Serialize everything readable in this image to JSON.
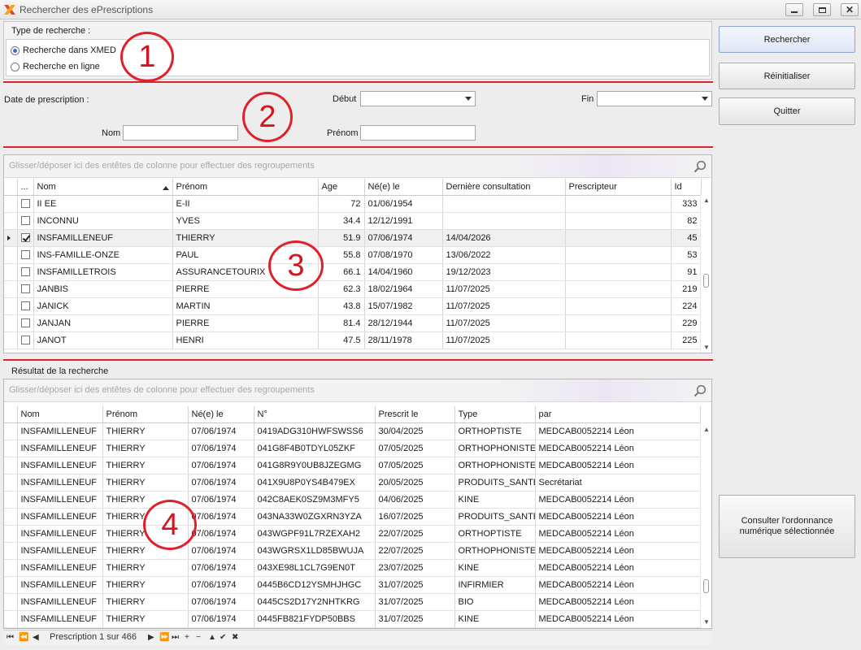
{
  "window": {
    "title": "Rechercher des ePrescriptions"
  },
  "search_type": {
    "label": "Type de recherche :",
    "options": [
      {
        "label": "Recherche dans XMED",
        "selected": true
      },
      {
        "label": "Recherche en ligne",
        "selected": false
      }
    ]
  },
  "filters": {
    "date_label": "Date de prescription :",
    "debut_label": "Début",
    "fin_label": "Fin",
    "nom_label": "Nom",
    "prenom_label": "Prénom",
    "debut_value": "",
    "fin_value": "",
    "nom_value": "",
    "prenom_value": ""
  },
  "annotations": [
    "1",
    "2",
    "3",
    "4"
  ],
  "patients": {
    "group_hint": "Glisser/déposer ici des entêtes de colonne pour effectuer des regroupements",
    "headers": [
      "...",
      "Nom",
      "Prénom",
      "Age",
      "Né(e) le",
      "Dernière consultation",
      "Prescripteur",
      "Id"
    ],
    "rows": [
      {
        "checked": false,
        "current": false,
        "nom": "II EE",
        "prenom": "E-II",
        "age": "72",
        "ne": "01/06/1954",
        "derniere": "",
        "prescripteur": "",
        "id": "333"
      },
      {
        "checked": false,
        "current": false,
        "nom": "INCONNU",
        "prenom": "YVES",
        "age": "34.4",
        "ne": "12/12/1991",
        "derniere": "",
        "prescripteur": "",
        "id": "82"
      },
      {
        "checked": true,
        "current": true,
        "nom": "INSFAMILLENEUF",
        "prenom": "THIERRY",
        "age": "51.9",
        "ne": "07/06/1974",
        "derniere": "14/04/2026",
        "prescripteur": "",
        "id": "45"
      },
      {
        "checked": false,
        "current": false,
        "nom": "INS-FAMILLE-ONZE",
        "prenom": "PAUL",
        "age": "55.8",
        "ne": "07/08/1970",
        "derniere": "13/06/2022",
        "prescripteur": "",
        "id": "53"
      },
      {
        "checked": false,
        "current": false,
        "nom": "INSFAMILLETROIS",
        "prenom": "ASSURANCETOURIX",
        "age": "66.1",
        "ne": "14/04/1960",
        "derniere": "19/12/2023",
        "prescripteur": "",
        "id": "91"
      },
      {
        "checked": false,
        "current": false,
        "nom": "JANBIS",
        "prenom": "PIERRE",
        "age": "62.3",
        "ne": "18/02/1964",
        "derniere": "11/07/2025",
        "prescripteur": "",
        "id": "219"
      },
      {
        "checked": false,
        "current": false,
        "nom": "JANICK",
        "prenom": "MARTIN",
        "age": "43.8",
        "ne": "15/07/1982",
        "derniere": "11/07/2025",
        "prescripteur": "",
        "id": "224"
      },
      {
        "checked": false,
        "current": false,
        "nom": "JANJAN",
        "prenom": "PIERRE",
        "age": "81.4",
        "ne": "28/12/1944",
        "derniere": "11/07/2025",
        "prescripteur": "",
        "id": "229"
      },
      {
        "checked": false,
        "current": false,
        "nom": "JANOT",
        "prenom": "HENRI",
        "age": "47.5",
        "ne": "28/11/1978",
        "derniere": "11/07/2025",
        "prescripteur": "",
        "id": "225"
      }
    ]
  },
  "results": {
    "label": "Résultat de la recherche",
    "group_hint": "Glisser/déposer ici des entêtes de colonne pour effectuer des regroupements",
    "headers": [
      "Nom",
      "Prénom",
      "Né(e) le",
      "N°",
      "Prescrit le",
      "Type",
      "par"
    ],
    "rows": [
      [
        "INSFAMILLENEUF",
        "THIERRY",
        "07/06/1974",
        "0419ADG310HWFSWSS6",
        "30/04/2025",
        "ORTHOPTISTE",
        "MEDCAB0052214 Léon"
      ],
      [
        "INSFAMILLENEUF",
        "THIERRY",
        "07/06/1974",
        "041G8F4B0TDYL05ZKF",
        "07/05/2025",
        "ORTHOPHONISTE",
        "MEDCAB0052214 Léon"
      ],
      [
        "INSFAMILLENEUF",
        "THIERRY",
        "07/06/1974",
        "041G8R9Y0UB8JZEGMG",
        "07/05/2025",
        "ORTHOPHONISTE",
        "MEDCAB0052214 Léon"
      ],
      [
        "INSFAMILLENEUF",
        "THIERRY",
        "07/06/1974",
        "041X9U8P0YS4B479EX",
        "20/05/2025",
        "PRODUITS_SANTE",
        "Secrétariat"
      ],
      [
        "INSFAMILLENEUF",
        "THIERRY",
        "07/06/1974",
        "042C8AEK0SZ9M3MFY5",
        "04/06/2025",
        "KINE",
        "MEDCAB0052214 Léon"
      ],
      [
        "INSFAMILLENEUF",
        "THIERRY",
        "07/06/1974",
        "043NA33W0ZGXRN3YZA",
        "16/07/2025",
        "PRODUITS_SANTE",
        "MEDCAB0052214 Léon"
      ],
      [
        "INSFAMILLENEUF",
        "THIERRY",
        "07/06/1974",
        "043WGPF91L7RZEXAH2",
        "22/07/2025",
        "ORTHOPTISTE",
        "MEDCAB0052214 Léon"
      ],
      [
        "INSFAMILLENEUF",
        "THIERRY",
        "07/06/1974",
        "043WGRSX1LD85BWUJA",
        "22/07/2025",
        "ORTHOPHONISTE",
        "MEDCAB0052214 Léon"
      ],
      [
        "INSFAMILLENEUF",
        "THIERRY",
        "07/06/1974",
        "043XE98L1CL7G9EN0T",
        "23/07/2025",
        "KINE",
        "MEDCAB0052214 Léon"
      ],
      [
        "INSFAMILLENEUF",
        "THIERRY",
        "07/06/1974",
        "0445B6CD12YSMHJHGC",
        "31/07/2025",
        "INFIRMIER",
        "MEDCAB0052214 Léon"
      ],
      [
        "INSFAMILLENEUF",
        "THIERRY",
        "07/06/1974",
        "0445CS2D17Y2NHTKRG",
        "31/07/2025",
        "BIO",
        "MEDCAB0052214 Léon"
      ],
      [
        "INSFAMILLENEUF",
        "THIERRY",
        "07/06/1974",
        "0445FB821FYDP50BBS",
        "31/07/2025",
        "KINE",
        "MEDCAB0052214 Léon"
      ]
    ]
  },
  "navigator": {
    "text": "Prescription 1 sur 466"
  },
  "buttons": {
    "search": "Rechercher",
    "reset": "Réinitialiser",
    "quit": "Quitter",
    "consult": "Consulter l'ordonnance numérique sélectionnée"
  },
  "colors": {
    "accent": "#3b6fc9",
    "annotation_red": "#e0202a"
  }
}
